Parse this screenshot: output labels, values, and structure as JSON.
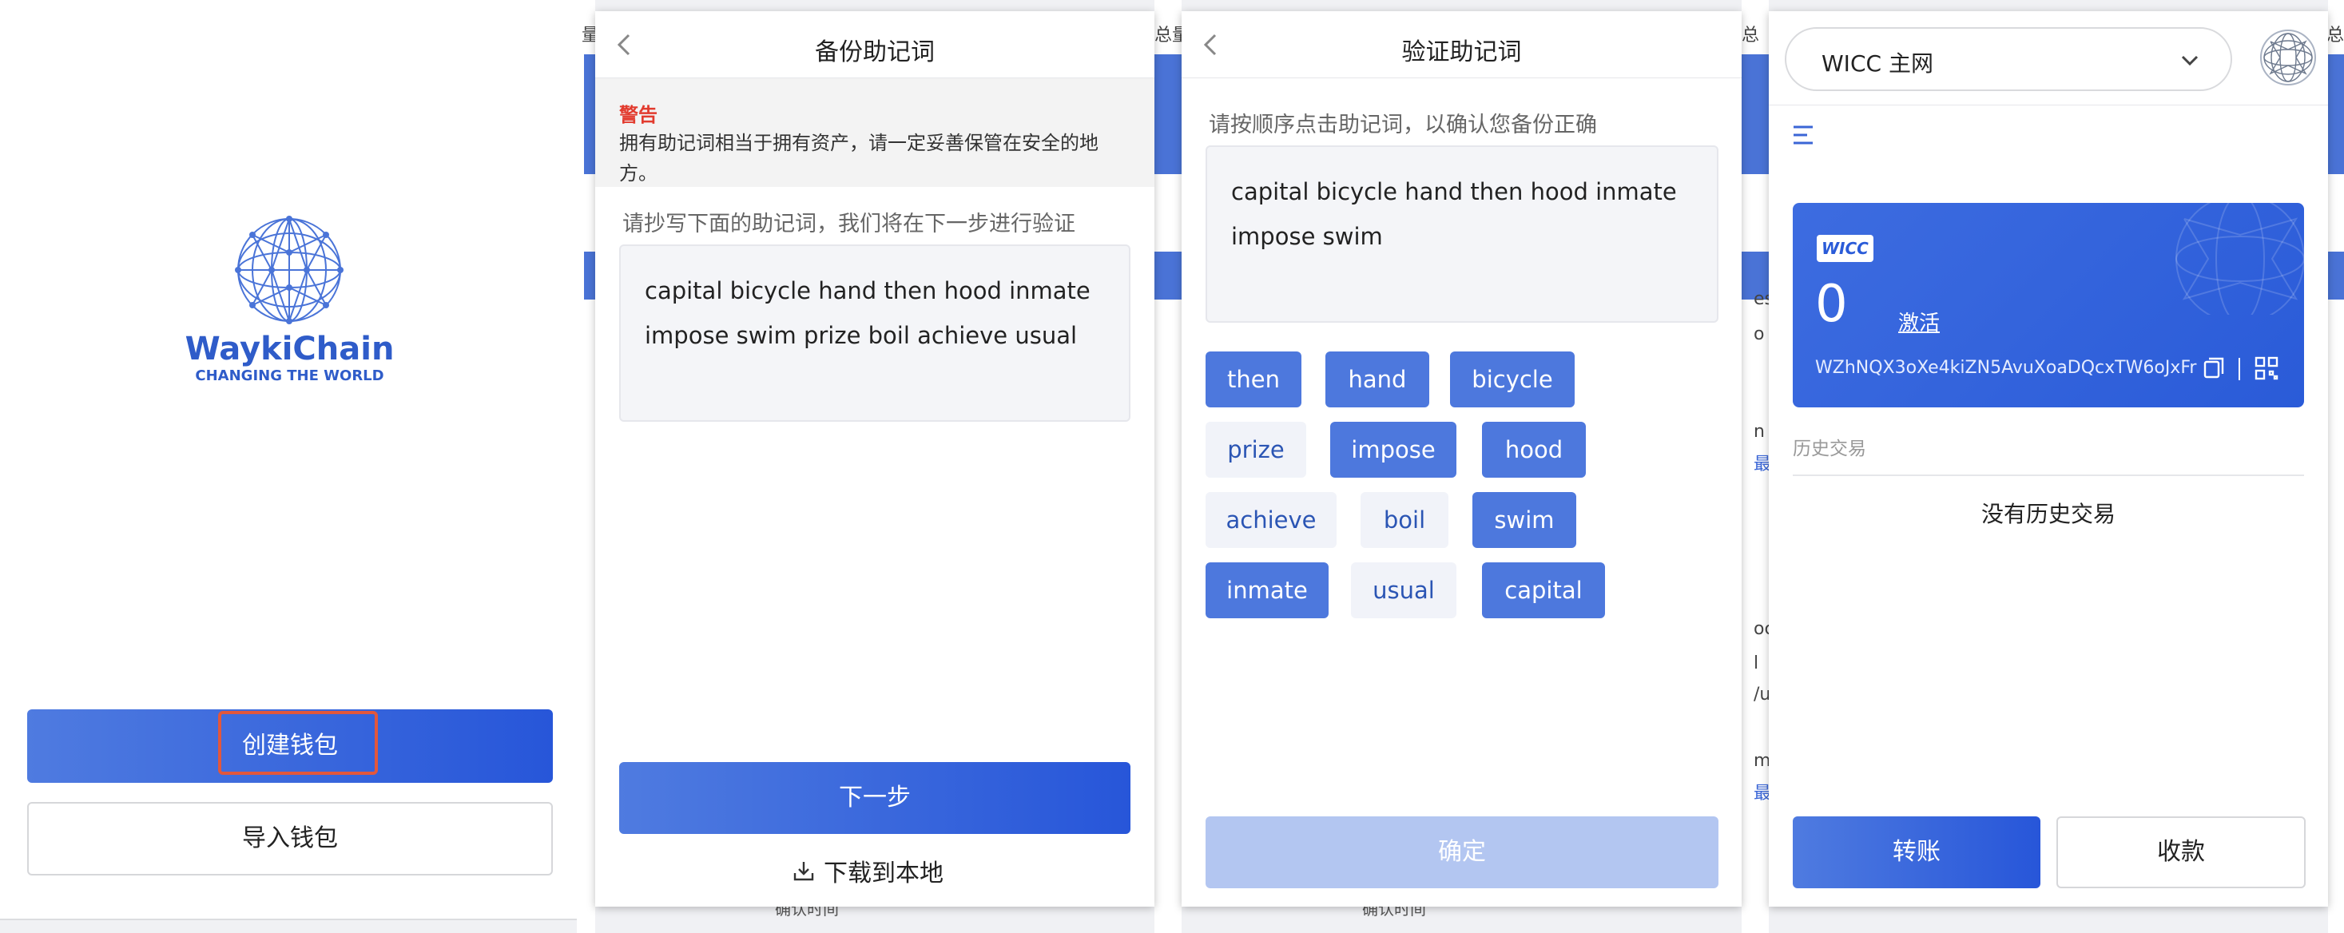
{
  "screen1": {
    "brand_name": "WaykiChain",
    "brand_tagline": "CHANGING THE WORLD",
    "create_button": "创建钱包",
    "import_button": "导入钱包"
  },
  "screen2": {
    "title": "备份助记词",
    "warning_title": "警告",
    "warning_text": "拥有助记词相当于拥有资产，请一定妥善保管在安全的地方。",
    "instruction": "请抄写下面的助记词，我们将在下一步进行验证",
    "mnemonic": "capital bicycle hand then hood inmate impose swim prize boil achieve usual",
    "next_button": "下一步",
    "download_label": "下载到本地"
  },
  "screen3": {
    "title": "验证助记词",
    "instruction": "请按顺序点击助记词，以确认您备份正确",
    "selected": "capital bicycle hand then hood inmate impose swim",
    "words": [
      {
        "w": "then",
        "selected": true
      },
      {
        "w": "hand",
        "selected": true
      },
      {
        "w": "bicycle",
        "selected": true
      },
      {
        "w": "prize",
        "selected": false
      },
      {
        "w": "impose",
        "selected": true
      },
      {
        "w": "hood",
        "selected": true
      },
      {
        "w": "achieve",
        "selected": false
      },
      {
        "w": "boil",
        "selected": false
      },
      {
        "w": "swim",
        "selected": true
      },
      {
        "w": "inmate",
        "selected": true
      },
      {
        "w": "usual",
        "selected": false
      },
      {
        "w": "capital",
        "selected": true
      }
    ],
    "confirm_button": "确定"
  },
  "screen4": {
    "network": "WICC 主网",
    "token_badge": "WICC",
    "balance": "0",
    "activate_link": "激活",
    "address": "WZhNQX3oXe4kiZN5AvuXoaDQcxTW6oJxFr",
    "history_label": "历史交易",
    "no_history": "没有历史交易",
    "transfer_button": "转账",
    "receive_button": "收款"
  },
  "background": {
    "fragment_1": "量",
    "fragment_2": "总量",
    "fragment_3": "总",
    "fragment_4": "总",
    "fragment_5": "es",
    "fragment_6": "o",
    "fragment_7": "n",
    "fragment_8": "最",
    "fragment_9": "oc",
    "fragment_10": "l",
    "fragment_11": "/u",
    "fragment_12": "m",
    "fragment_13": "最",
    "fragment_14": "确认时间",
    "fragment_15": "确认时间"
  },
  "colors": {
    "primary": "#2756d9",
    "chip_on": "#4d78dd",
    "warning": "#e23b2e",
    "highlight": "#e2573c"
  }
}
